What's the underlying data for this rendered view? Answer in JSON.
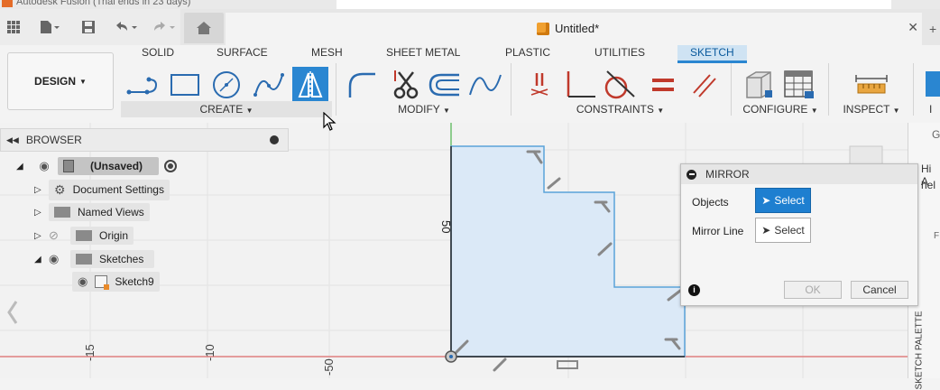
{
  "window": {
    "title": "Autodesk Fusion (Trial ends in 23 days)",
    "document_name": "Untitled*"
  },
  "ribbon": {
    "tabs": [
      {
        "label": "SOLID",
        "active": false
      },
      {
        "label": "SURFACE",
        "active": false
      },
      {
        "label": "MESH",
        "active": false
      },
      {
        "label": "SHEET METAL",
        "active": false
      },
      {
        "label": "PLASTIC",
        "active": false
      },
      {
        "label": "UTILITIES",
        "active": false
      },
      {
        "label": "SKETCH",
        "active": true
      }
    ],
    "workspace": "DESIGN",
    "groups": {
      "create": "CREATE",
      "modify": "MODIFY",
      "constraints": "CONSTRAINTS",
      "configure": "CONFIGURE",
      "inspect": "INSPECT",
      "insert_partial": "I"
    },
    "tools": {
      "create": [
        "line-icon",
        "rectangle-icon",
        "circle-icon",
        "spline-icon",
        "mirror-icon"
      ],
      "modify": [
        "fillet-icon",
        "trim-icon",
        "offset-icon",
        "curve-icon"
      ],
      "constraints": [
        "coincident-icon",
        "perpendicular-icon",
        "tangent-icon",
        "equal-icon",
        "parallel-icon"
      ],
      "configure": [
        "configure-cube-icon",
        "table-icon"
      ],
      "inspect": [
        "measure-icon"
      ]
    },
    "selected_tool": "mirror-icon"
  },
  "browser": {
    "title": "BROWSER",
    "items": [
      {
        "label": "(Unsaved)",
        "expanded": true,
        "level": 0
      },
      {
        "label": "Document Settings",
        "expanded": false,
        "level": 1
      },
      {
        "label": "Named Views",
        "expanded": false,
        "level": 1
      },
      {
        "label": "Origin",
        "expanded": false,
        "level": 1
      },
      {
        "label": "Sketches",
        "expanded": true,
        "level": 1
      },
      {
        "label": "Sketch9",
        "expanded": false,
        "level": 2
      }
    ]
  },
  "canvas": {
    "dimension_label": "50",
    "axis_labels": [
      "-15",
      "-10",
      "-50"
    ]
  },
  "mirror_dialog": {
    "title": "MIRROR",
    "rows": [
      {
        "label": "Objects",
        "button": "Select",
        "active": true
      },
      {
        "label": "Mirror Line",
        "button": "Select",
        "active": false
      }
    ],
    "ok_label": "OK",
    "cancel_label": "Cancel"
  },
  "right_panel": {
    "tab_partial": "G",
    "chat_text_line1": "Hi A",
    "chat_text_line2": "hel",
    "vertical_label": "SKETCH PALETTE",
    "f_label": "F"
  },
  "colors": {
    "accent": "#2a86d1",
    "sketch_fill": "#dbe9f7",
    "sketch_stroke": "#5ba3d9",
    "axis_green": "#6cc06c",
    "axis_red": "#e08080"
  }
}
